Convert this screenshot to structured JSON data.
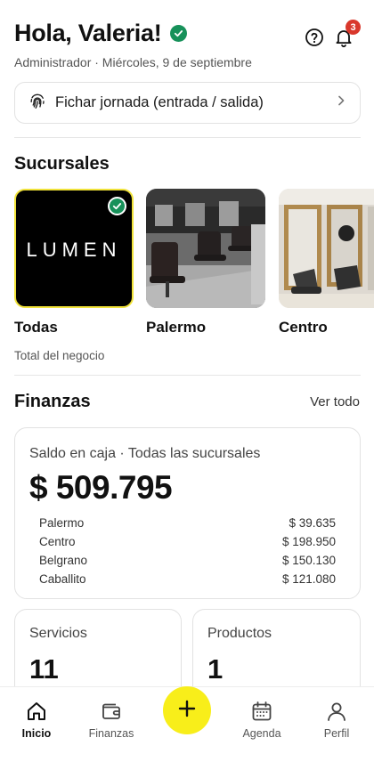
{
  "header": {
    "greeting": "Hola, Valeria!",
    "subtitle": "Administrador · Miércoles, 9 de septiembre",
    "notifications_count": "3"
  },
  "clock_in": {
    "label": "Fichar jornada (entrada / salida)"
  },
  "branches": {
    "title": "Sucursales",
    "items": [
      {
        "name": "Todas",
        "sub": "Total del negocio",
        "logo_text": "LUMEN",
        "selected": true
      },
      {
        "name": "Palermo",
        "sub": ""
      },
      {
        "name": "Centro",
        "sub": ""
      }
    ]
  },
  "finance": {
    "title": "Finanzas",
    "see_all": "Ver todo",
    "balance_label": "Saldo en caja · Todas las sucursales",
    "balance_amount": "$ 509.795",
    "breakdown": [
      {
        "branch": "Palermo",
        "amount": "$ 39.635"
      },
      {
        "branch": "Centro",
        "amount": "$ 198.950"
      },
      {
        "branch": "Belgrano",
        "amount": "$ 150.130"
      },
      {
        "branch": "Caballito",
        "amount": "$ 121.080"
      }
    ],
    "stats": [
      {
        "label": "Servicios",
        "value": "11"
      },
      {
        "label": "Productos",
        "value": "1"
      }
    ]
  },
  "tabbar": {
    "items": [
      {
        "label": "Inicio",
        "icon": "home-icon",
        "active": true
      },
      {
        "label": "Finanzas",
        "icon": "wallet-icon"
      },
      {
        "label": "Agenda",
        "icon": "calendar-icon"
      },
      {
        "label": "Perfil",
        "icon": "user-icon"
      }
    ],
    "fab_icon": "plus-icon"
  },
  "colors": {
    "accent_yellow": "#f8ee1a",
    "verified_green": "#17915a",
    "badge_red": "#d9382c"
  }
}
